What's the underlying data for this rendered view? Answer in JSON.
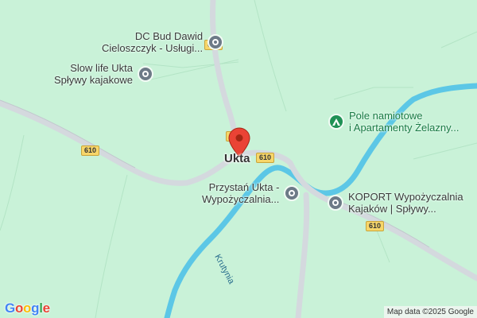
{
  "map": {
    "town_label": "Ukta",
    "river_label": "Krutynia",
    "roads": [
      {
        "number_label": "609"
      },
      {
        "number_label": "610"
      }
    ],
    "pois": [
      {
        "label_line1": "DC Bud Dawid",
        "label_line2": "Cieloszczyk - Usługi...",
        "icon": "generic-pin-icon"
      },
      {
        "label_line1": "Slow life Ukta",
        "label_line2": "Spływy kajakowe",
        "icon": "generic-pin-icon"
      },
      {
        "label_line1": "Pole namiotowe",
        "label_line2": "i Apartamenty Żelazny...",
        "icon": "campground-icon"
      },
      {
        "label_line1": "Przystań Ukta -",
        "label_line2": "Wypożyczalnia...",
        "icon": "generic-pin-icon"
      },
      {
        "label_line1": "KOPORT Wypożyczalnia",
        "label_line2": "Kajaków | Spływy...",
        "icon": "generic-pin-icon"
      }
    ],
    "colors": {
      "land": "#c9f2d8",
      "road": "#d4d9de",
      "water": "#5cc7e6",
      "marker": "#ea4335",
      "poi_green": "#1f9155",
      "poi_gray": "#6d7a87"
    }
  },
  "branding": {
    "logo": [
      "G",
      "o",
      "o",
      "g",
      "l",
      "e"
    ],
    "logo_colors": [
      "#4285f4",
      "#ea4335",
      "#fbbc05",
      "#4285f4",
      "#34a853",
      "#ea4335"
    ],
    "attribution": "Map data ©2025 Google"
  }
}
